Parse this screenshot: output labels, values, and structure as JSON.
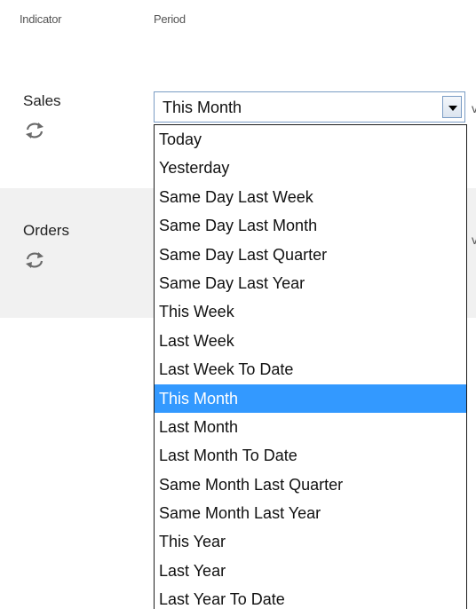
{
  "headers": {
    "indicator": "Indicator",
    "period": "Period"
  },
  "rows": [
    {
      "label": "Sales",
      "icon": "refresh-icon"
    },
    {
      "label": "Orders",
      "icon": "refresh-icon"
    }
  ],
  "period_select": {
    "value": "This Month",
    "options": [
      "Today",
      "Yesterday",
      "Same Day Last Week",
      "Same Day Last Month",
      "Same Day Last Quarter",
      "Same Day Last Year",
      "This Week",
      "Last Week",
      "Last Week To Date",
      "This Month",
      "Last Month",
      "Last Month To Date",
      "Same Month Last Quarter",
      "Same Month Last Year",
      "This Year",
      "Last Year",
      "Last Year To Date"
    ],
    "highlighted": "This Month"
  },
  "colors": {
    "highlight": "#3399ff",
    "row_alt_bg": "#f1f1f1",
    "select_border": "#7a9cc4"
  }
}
